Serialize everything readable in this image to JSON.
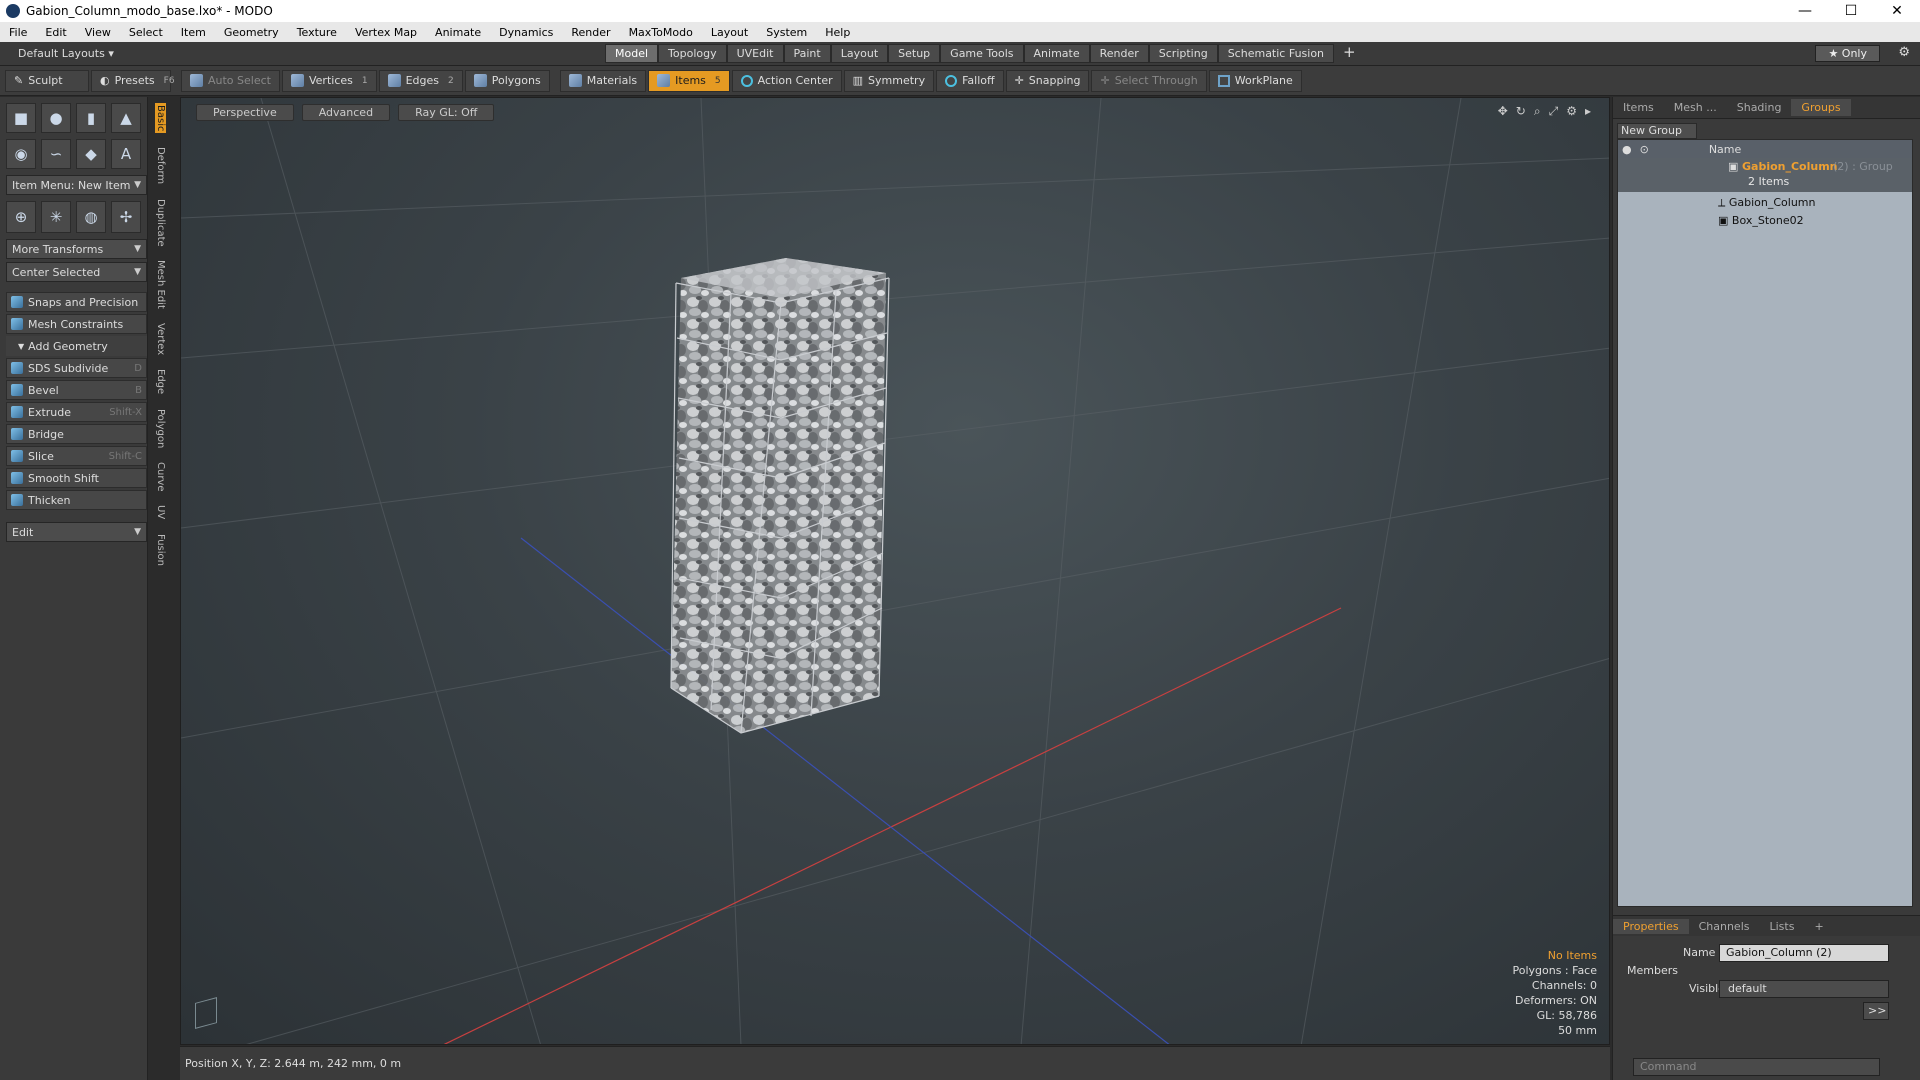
{
  "window": {
    "title": "Gabion_Column_modo_base.lxo* - MODO",
    "min": "—",
    "max": "☐",
    "close": "✕"
  },
  "menu": [
    "File",
    "Edit",
    "View",
    "Select",
    "Item",
    "Geometry",
    "Texture",
    "Vertex Map",
    "Animate",
    "Dynamics",
    "Render",
    "MaxToModo",
    "Layout",
    "System",
    "Help"
  ],
  "layout_dropdown": "Default Layouts",
  "layout_tabs": [
    "Model",
    "Topology",
    "UVEdit",
    "Paint",
    "Layout",
    "Setup",
    "Game Tools",
    "Animate",
    "Render",
    "Scripting",
    "Schematic Fusion"
  ],
  "layout_tabs_plus": "+",
  "only_button": "★ Only",
  "toolbar": {
    "sculpt": "Sculpt",
    "presets": "Presets",
    "presets_key": "F6",
    "auto_select": "Auto Select",
    "vertices": "Vertices",
    "vertices_num": "1",
    "edges": "Edges",
    "edges_num": "2",
    "polygons": "Polygons",
    "materials": "Materials",
    "items": "Items",
    "items_num": "5",
    "action_center": "Action Center",
    "symmetry": "Symmetry",
    "falloff": "Falloff",
    "snapping": "Snapping",
    "select_through": "Select Through",
    "workplane": "WorkPlane"
  },
  "left_panel": {
    "item_menu": "Item Menu: New Item",
    "more_transforms": "More Transforms",
    "center_selected": "Center Selected",
    "snaps": "Snaps and Precision",
    "mesh_constraints": "Mesh Constraints",
    "add_geometry": "Add Geometry",
    "tools": [
      {
        "label": "SDS Subdivide",
        "shortcut": "D"
      },
      {
        "label": "Bevel",
        "shortcut": "B"
      },
      {
        "label": "Extrude",
        "shortcut": "Shift-X"
      },
      {
        "label": "Bridge",
        "shortcut": ""
      },
      {
        "label": "Slice",
        "shortcut": "Shift-C"
      },
      {
        "label": "Smooth Shift",
        "shortcut": ""
      },
      {
        "label": "Thicken",
        "shortcut": ""
      }
    ],
    "edit_dropdown": "Edit",
    "vertical_tabs": [
      "Basic",
      "Deform",
      "Duplicate",
      "Mesh Edit",
      "Vertex",
      "Edge",
      "Polygon",
      "Curve",
      "UV",
      "Fusion"
    ]
  },
  "viewport": {
    "view_mode": "Perspective",
    "shading": "Advanced",
    "raygl": "Ray GL: Off",
    "info": {
      "no_items": "No Items",
      "polygons": "Polygons : Face",
      "channels": "Channels: 0",
      "deformers": "Deformers: ON",
      "gl": "GL: 58,786",
      "scale": "50 mm"
    }
  },
  "status_bar": {
    "position": "Position X, Y, Z:  2.644 m, 242 mm, 0 m"
  },
  "right_panel": {
    "tabs": [
      "Items",
      "Mesh ...",
      "Shading",
      "Groups"
    ],
    "new_group": "New Group",
    "name_header": "Name",
    "group_name": "Gabion_Column",
    "group_suffix": "(2) : Group",
    "group_count": "2 Items",
    "children": [
      "Gabion_Column",
      "Box_Stone02"
    ]
  },
  "properties": {
    "tabs": [
      "Properties",
      "Channels",
      "Lists",
      "+"
    ],
    "name_label": "Name",
    "name_value": "Gabion_Column (2)",
    "members": "Members",
    "visible_label": "Visible",
    "visible_value": "default",
    "more_btn": ">>"
  },
  "command": {
    "placeholder": "Command"
  },
  "colors": {
    "accent": "#e59a22",
    "red_axis": "#c84040",
    "blue_axis": "#3a4fb0"
  }
}
